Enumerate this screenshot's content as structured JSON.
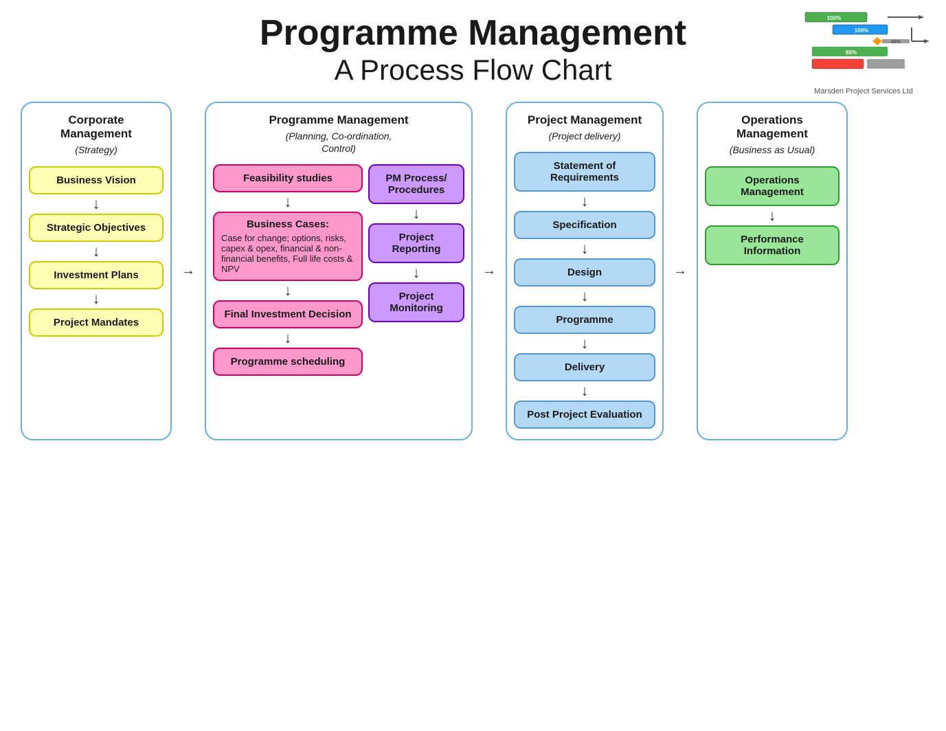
{
  "header": {
    "title": "Programme Management",
    "subtitle": "A Process Flow Chart",
    "logo_text": "Marsden Project Services Ltd"
  },
  "columns": {
    "corporate": {
      "title": "Corporate Management",
      "subtitle": "(Strategy)",
      "items": [
        "Business Vision",
        "Strategic Objectives",
        "Investment Plans",
        "Project Mandates"
      ]
    },
    "programme": {
      "title": "Programme Management",
      "subtitle": "(Planning, Co-ordination, Control)",
      "left_items": [
        {
          "label": "Feasibility studies",
          "type": "pink"
        },
        {
          "label": "Business Cases:",
          "sublabel": "Case for change; options, risks, capex & opex, financial & non-financial benefits, Full life costs & NPV",
          "type": "pink"
        },
        {
          "label": "Final Investment Decision",
          "type": "pink"
        },
        {
          "label": "Programme scheduling",
          "type": "pink"
        }
      ],
      "right_items": [
        {
          "label": "PM Process/ Procedures",
          "type": "purple"
        },
        {
          "label": "Project Reporting",
          "type": "purple"
        },
        {
          "label": "Project Monitoring",
          "type": "purple"
        }
      ]
    },
    "project": {
      "title": "Project Management",
      "subtitle": "(Project delivery)",
      "items": [
        "Statement of Requirements",
        "Specification",
        "Design",
        "Programme",
        "Delivery",
        "Post Project Evaluation"
      ]
    },
    "operations": {
      "title": "Operations Management",
      "subtitle": "(Business as Usual)",
      "items": [
        "Operations Management",
        "Performance Information"
      ]
    }
  },
  "arrows": {
    "down": "↓",
    "right": "→"
  }
}
